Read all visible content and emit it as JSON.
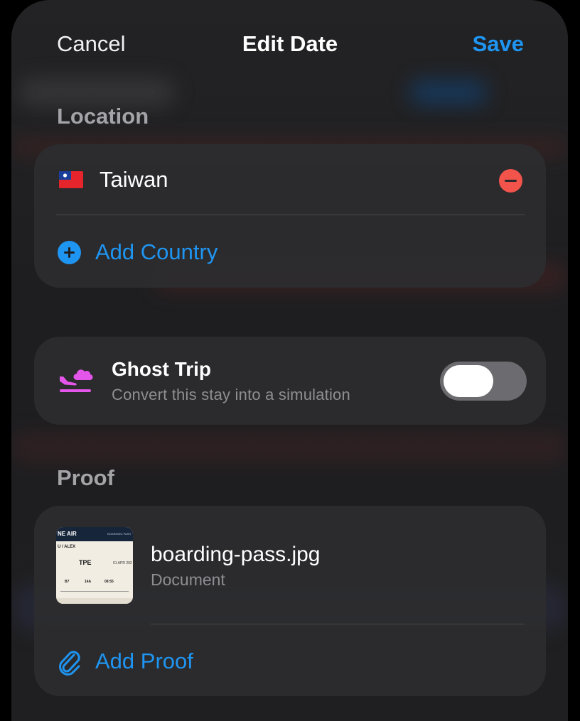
{
  "nav": {
    "cancel": "Cancel",
    "title": "Edit Date",
    "save": "Save"
  },
  "colors": {
    "accent": "#1f95f2",
    "destructive": "#f2544c",
    "ghost": "#e455ea"
  },
  "location": {
    "label": "Location",
    "countries": [
      {
        "flag": "taiwan-flag-icon",
        "name": "Taiwan"
      }
    ],
    "add_label": "Add Country"
  },
  "ghost_trip": {
    "icon": "plane-landing-cloud-icon",
    "title": "Ghost Trip",
    "subtitle": "Convert this stay into a simulation",
    "enabled": false
  },
  "proof": {
    "label": "Proof",
    "files": [
      {
        "name": "boarding-pass.jpg",
        "type": "Document",
        "thumbnail": {
          "airline": "NE AIR",
          "header": "BOARDING PASS",
          "passenger": "U / ALEX",
          "code": "TPE",
          "date": "01 APR 202",
          "fields": [
            "B7",
            "14A",
            "08:55"
          ]
        }
      }
    ],
    "add_label": "Add Proof"
  }
}
